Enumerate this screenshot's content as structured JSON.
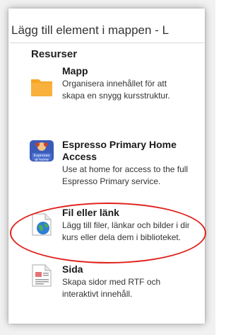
{
  "dialog": {
    "title": "Lägg till element i mappen - L"
  },
  "section": {
    "heading": "Resurser"
  },
  "resources": [
    {
      "name": "Mapp",
      "description": "Organisera innehållet för att skapa en snygg kursstruktur.",
      "icon": "folder-icon"
    },
    {
      "name": "Espresso Primary Home Access",
      "description": "Use at home for access to the full Espresso Primary service.",
      "icon": "espresso-at-home-icon",
      "icon_text_top": "Espresso",
      "icon_text_bottom": "at home"
    },
    {
      "name": "Fil eller länk",
      "description": "Lägg till filer, länkar och bilder i din kurs eller dela dem i biblioteket.",
      "icon": "file-globe-icon"
    },
    {
      "name": "Sida",
      "description": "Skapa sidor med RTF och interaktivt innehåll.",
      "icon": "page-icon"
    }
  ],
  "colors": {
    "highlight_ring": "#e0201b",
    "folder": "#f5a623",
    "espresso_bg": "#3a5bb8"
  }
}
